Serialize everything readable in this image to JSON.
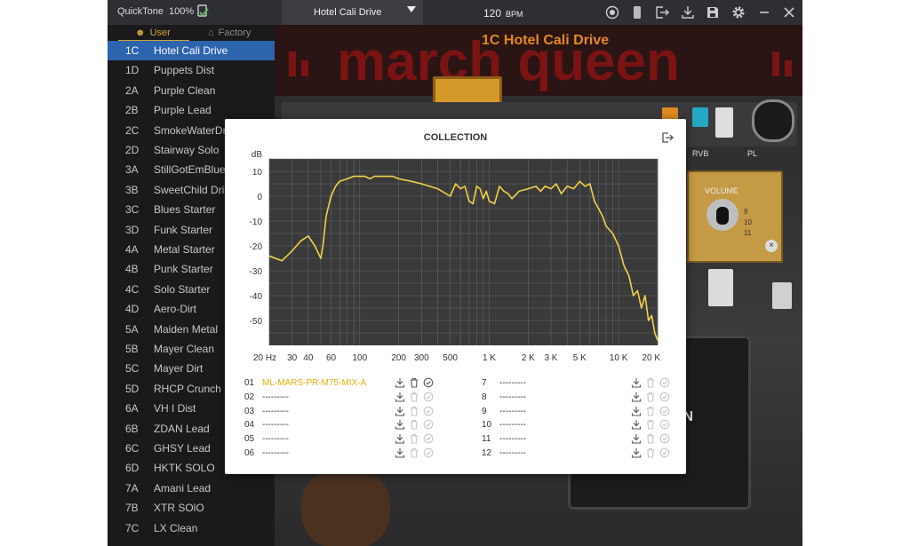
{
  "topbar": {
    "brand": "QuickTone",
    "version": "100%",
    "preset_name": "Hotel Cali Drive",
    "bpm_value": "120",
    "bpm_unit": "BPM"
  },
  "sidebar": {
    "tabs": [
      {
        "label": "User"
      },
      {
        "label": "Factory"
      }
    ],
    "selected_index": 0,
    "presets": [
      {
        "slot": "1C",
        "name": "Hotel Cali Drive"
      },
      {
        "slot": "1D",
        "name": "Puppets Dist"
      },
      {
        "slot": "2A",
        "name": "Purple Clean"
      },
      {
        "slot": "2B",
        "name": "Purple Lead"
      },
      {
        "slot": "2C",
        "name": "SmokeWaterDr"
      },
      {
        "slot": "2D",
        "name": "Stairway Solo"
      },
      {
        "slot": "3A",
        "name": "StillGotEmBlue"
      },
      {
        "slot": "3B",
        "name": "SweetChild Dri"
      },
      {
        "slot": "3C",
        "name": "Blues Starter"
      },
      {
        "slot": "3D",
        "name": "Funk Starter"
      },
      {
        "slot": "4A",
        "name": "Metal Starter"
      },
      {
        "slot": "4B",
        "name": "Punk Starter"
      },
      {
        "slot": "4C",
        "name": "Solo Starter"
      },
      {
        "slot": "4D",
        "name": "Aero-Dirt"
      },
      {
        "slot": "5A",
        "name": "Maiden Metal"
      },
      {
        "slot": "5B",
        "name": "Mayer Clean"
      },
      {
        "slot": "5C",
        "name": "Mayer Dirt"
      },
      {
        "slot": "5D",
        "name": "RHCP Crunch"
      },
      {
        "slot": "6A",
        "name": "VH I Dist"
      },
      {
        "slot": "6B",
        "name": "ZDAN   Lead"
      },
      {
        "slot": "6C",
        "name": "GHSY   Lead"
      },
      {
        "slot": "6D",
        "name": "HKTK  SOLO"
      },
      {
        "slot": "7A",
        "name": "Amani   Lead"
      },
      {
        "slot": "7B",
        "name": "XTR  SOlO"
      },
      {
        "slot": "7C",
        "name": "LX  Clean"
      }
    ]
  },
  "rig": {
    "preset_title": "1C Hotel Cali Drive",
    "banner_text": "march queen",
    "pedal_labels": [
      "RVB",
      "PL"
    ],
    "amp_knob_label": "VOLUME",
    "amp_knob_numbers": [
      "9",
      "10",
      "11"
    ],
    "cab_text": "ON"
  },
  "dialog": {
    "title": "COLLECTION",
    "slots_left": [
      {
        "num": "01",
        "name": "ML-MARS-PR-M75-MIX-A",
        "active": true
      },
      {
        "num": "02",
        "name": "---------",
        "active": false
      },
      {
        "num": "03",
        "name": "---------",
        "active": false
      },
      {
        "num": "04",
        "name": "---------",
        "active": false
      },
      {
        "num": "05",
        "name": "---------",
        "active": false
      },
      {
        "num": "06",
        "name": "---------",
        "active": false
      }
    ],
    "slots_right": [
      {
        "num": "7",
        "name": "---------",
        "active": false
      },
      {
        "num": "8",
        "name": "---------",
        "active": false
      },
      {
        "num": "9",
        "name": "---------",
        "active": false
      },
      {
        "num": "10",
        "name": "---------",
        "active": false
      },
      {
        "num": "11",
        "name": "---------",
        "active": false
      },
      {
        "num": "12",
        "name": "---------",
        "active": false
      }
    ]
  },
  "colors": {
    "accent": "#d4a43a",
    "selection": "#2d64ae",
    "curve": "#f2d14a",
    "plot_bg": "#3a3a3a",
    "rig_title": "#e08a1e"
  },
  "chart_data": {
    "type": "line",
    "ylabel": "dB",
    "x_scale": "log",
    "xlim": [
      20,
      20000
    ],
    "ylim": [
      -60,
      15
    ],
    "y_ticks": [
      10,
      0,
      -10,
      -20,
      -30,
      -40,
      -50
    ],
    "x_ticks": [
      {
        "v": 20,
        "label": "20 Hz"
      },
      {
        "v": 30,
        "label": "30"
      },
      {
        "v": 40,
        "label": "40"
      },
      {
        "v": 60,
        "label": "60"
      },
      {
        "v": 100,
        "label": "100"
      },
      {
        "v": 200,
        "label": "200"
      },
      {
        "v": 300,
        "label": "300"
      },
      {
        "v": 500,
        "label": "500"
      },
      {
        "v": 1000,
        "label": "1 K"
      },
      {
        "v": 2000,
        "label": "2 K"
      },
      {
        "v": 3000,
        "label": "3 K"
      },
      {
        "v": 5000,
        "label": "5 K"
      },
      {
        "v": 10000,
        "label": "10 K"
      },
      {
        "v": 20000,
        "label": "20 K"
      }
    ],
    "grid": true,
    "series": [
      {
        "x": [
          20,
          25,
          30,
          35,
          40,
          45,
          50,
          52,
          55,
          60,
          65,
          70,
          80,
          90,
          100,
          110,
          120,
          130,
          140,
          160,
          180,
          200,
          250,
          300,
          400,
          500,
          550,
          600,
          650,
          700,
          750,
          800,
          850,
          900,
          950,
          1000,
          1100,
          1200,
          1300,
          1400,
          1500,
          1700,
          2000,
          2300,
          2500,
          2700,
          3000,
          3300,
          3600,
          4000,
          4500,
          5000,
          5500,
          6000,
          6500,
          7000,
          7500,
          8000,
          9000,
          10000,
          11000,
          12000,
          13000,
          14000,
          15000,
          16000,
          17000,
          18000,
          19000,
          20000
        ],
        "y": [
          -24,
          -26,
          -22,
          -18,
          -16,
          -20,
          -25,
          -20,
          -8,
          0,
          4,
          6,
          7,
          8,
          8,
          8,
          7,
          8,
          8,
          8,
          8,
          7,
          6,
          5,
          3,
          0,
          5,
          3,
          4,
          -2,
          -3,
          4,
          3,
          -1,
          2,
          -2,
          -3,
          4,
          2,
          1,
          -1,
          2,
          3,
          4,
          2,
          4,
          3,
          5,
          1,
          4,
          3,
          6,
          4,
          5,
          -2,
          -5,
          -8,
          -12,
          -15,
          -20,
          -28,
          -32,
          -40,
          -38,
          -45,
          -40,
          -50,
          -48,
          -55,
          -58
        ]
      }
    ]
  }
}
